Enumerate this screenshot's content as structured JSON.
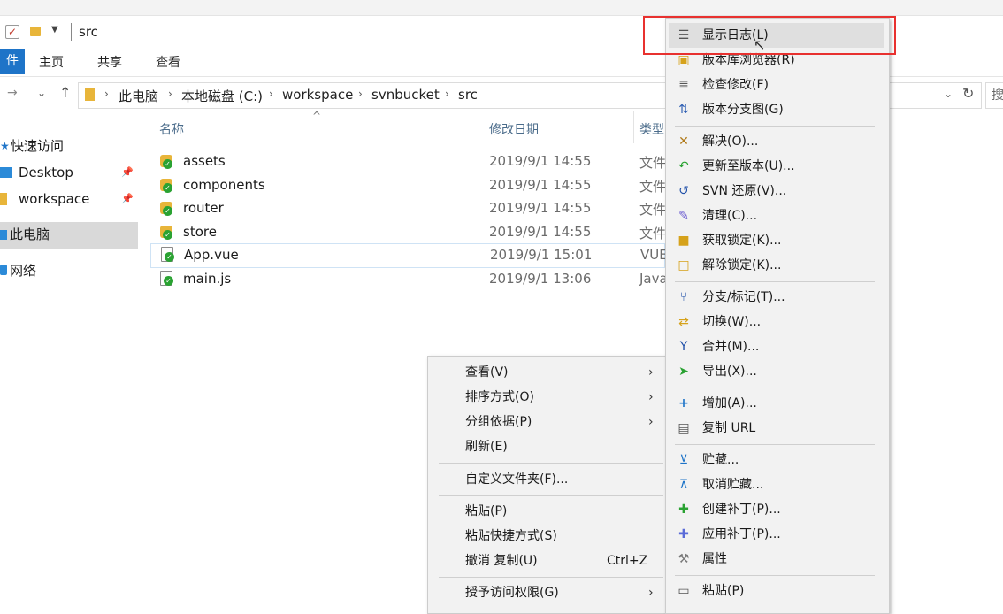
{
  "window": {
    "title": "src"
  },
  "ribbon": {
    "file_tab": "件",
    "tabs": [
      "主页",
      "共享",
      "查看"
    ]
  },
  "address": {
    "crumbs": [
      "此电脑",
      "本地磁盘 (C:)",
      "workspace",
      "svnbucket",
      "src"
    ],
    "search_placeholder": "搜"
  },
  "nav": {
    "quick_access": "快速访问",
    "desktop": "Desktop",
    "workspace": "workspace",
    "this_pc": "此电脑",
    "network": "网络"
  },
  "columns": {
    "name": "名称",
    "date": "修改日期",
    "type": "类型"
  },
  "files": [
    {
      "name": "assets",
      "date": "2019/9/1 14:55",
      "type": "文件",
      "icon": "svn-folder-icon"
    },
    {
      "name": "components",
      "date": "2019/9/1 14:55",
      "type": "文件",
      "icon": "svn-folder-icon"
    },
    {
      "name": "router",
      "date": "2019/9/1 14:55",
      "type": "文件",
      "icon": "svn-folder-icon"
    },
    {
      "name": "store",
      "date": "2019/9/1 14:55",
      "type": "文件",
      "icon": "svn-folder-icon"
    },
    {
      "name": "App.vue",
      "date": "2019/9/1 15:01",
      "type": "VUE",
      "icon": "svn-file-icon"
    },
    {
      "name": "main.js",
      "date": "2019/9/1 13:06",
      "type": "Java",
      "icon": "svn-file-icon"
    }
  ],
  "context_menu": {
    "items": [
      {
        "label": "查看(V)",
        "submenu": true
      },
      {
        "label": "排序方式(O)",
        "submenu": true
      },
      {
        "label": "分组依据(P)",
        "submenu": true
      },
      {
        "label": "刷新(E)"
      },
      {
        "label": "自定义文件夹(F)..."
      },
      {
        "label": "粘贴(P)"
      },
      {
        "label": "粘贴快捷方式(S)"
      },
      {
        "label": "撤消 复制(U)",
        "shortcut": "Ctrl+Z"
      },
      {
        "label": "授予访问权限(G)",
        "submenu": true
      }
    ]
  },
  "svn_menu": {
    "items": [
      {
        "label": "显示日志(L)",
        "icon": "log-icon"
      },
      {
        "label": "版本库浏览器(R)",
        "icon": "repo-browser-icon"
      },
      {
        "label": "检查修改(F)",
        "icon": "check-modifications-icon"
      },
      {
        "label": "版本分支图(G)",
        "icon": "revision-graph-icon"
      },
      {
        "label": "解决(O)...",
        "icon": "resolve-icon"
      },
      {
        "label": "更新至版本(U)...",
        "icon": "update-to-revision-icon"
      },
      {
        "label": "SVN 还原(V)...",
        "icon": "revert-icon"
      },
      {
        "label": "清理(C)...",
        "icon": "cleanup-icon"
      },
      {
        "label": "获取锁定(K)...",
        "icon": "lock-icon"
      },
      {
        "label": "解除锁定(K)...",
        "icon": "unlock-icon"
      },
      {
        "label": "分支/标记(T)...",
        "icon": "branch-tag-icon"
      },
      {
        "label": "切换(W)...",
        "icon": "switch-icon"
      },
      {
        "label": "合并(M)...",
        "icon": "merge-icon"
      },
      {
        "label": "导出(X)...",
        "icon": "export-icon"
      },
      {
        "label": "增加(A)...",
        "icon": "add-icon"
      },
      {
        "label": "复制 URL",
        "icon": "copy-url-icon"
      },
      {
        "label": "贮藏...",
        "icon": "shelve-icon"
      },
      {
        "label": "取消贮藏...",
        "icon": "unshelve-icon"
      },
      {
        "label": "创建补丁(P)...",
        "icon": "create-patch-icon"
      },
      {
        "label": "应用补丁(P)...",
        "icon": "apply-patch-icon"
      },
      {
        "label": "属性",
        "icon": "properties-icon"
      },
      {
        "label": "粘贴(P)",
        "icon": "paste-icon"
      }
    ]
  },
  "colors": {
    "accent": "#1e74c8",
    "highlight_box": "#e8312f",
    "svn_green": "#2aa232",
    "folder": "#e8b53a"
  }
}
